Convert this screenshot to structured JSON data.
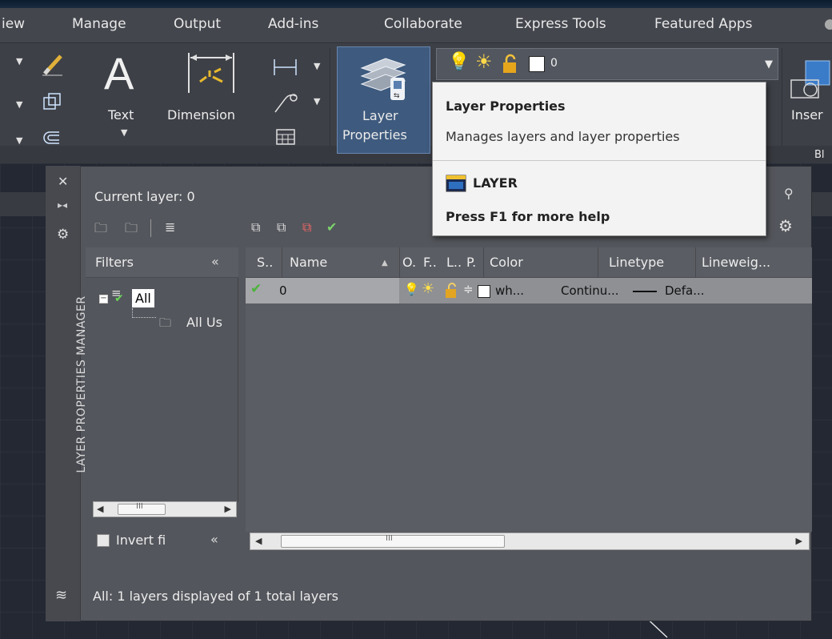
{
  "tabs": [
    "iew",
    "Manage",
    "Output",
    "Add-ins",
    "Collaborate",
    "Express Tools",
    "Featured Apps"
  ],
  "ribbon": {
    "text_label": "Text",
    "dimension_label": "Dimension",
    "layer_props_line1": "Layer",
    "layer_props_line2": "Properties",
    "insert_label": "Inser",
    "block_panel_label": "Bl"
  },
  "layer_combo": {
    "value": "0"
  },
  "tooltip": {
    "title": "Layer Properties",
    "description": "Manages layers and layer properties",
    "command": "LAYER",
    "help": "Press F1 for more help"
  },
  "palette": {
    "title": "LAYER PROPERTIES MANAGER",
    "current_layer": "Current layer: 0",
    "filters_header": "Filters",
    "filter_tree": [
      {
        "label": "All"
      },
      {
        "label": "All Us"
      }
    ],
    "invert_filter_label": "Invert fi",
    "columns": [
      "S..",
      "Name",
      "O.",
      "F..",
      "L..",
      "P.",
      "Color",
      "Linetype",
      "Lineweig..."
    ],
    "layers": [
      {
        "name": "0",
        "color": "wh...",
        "linetype": "Continu...",
        "lineweight": "Defa..."
      }
    ],
    "status": "All: 1 layers displayed of 1 total layers"
  },
  "colors": {
    "ribbon_bg": "#3d4047",
    "tab_bg": "#43464d",
    "pressed_button": "#3e5a7e",
    "palette_bg": "#53565c",
    "tooltip_bg": "#f3f3f3",
    "selected_row": "#a6a7ab",
    "drawing_bg": "#232833"
  }
}
